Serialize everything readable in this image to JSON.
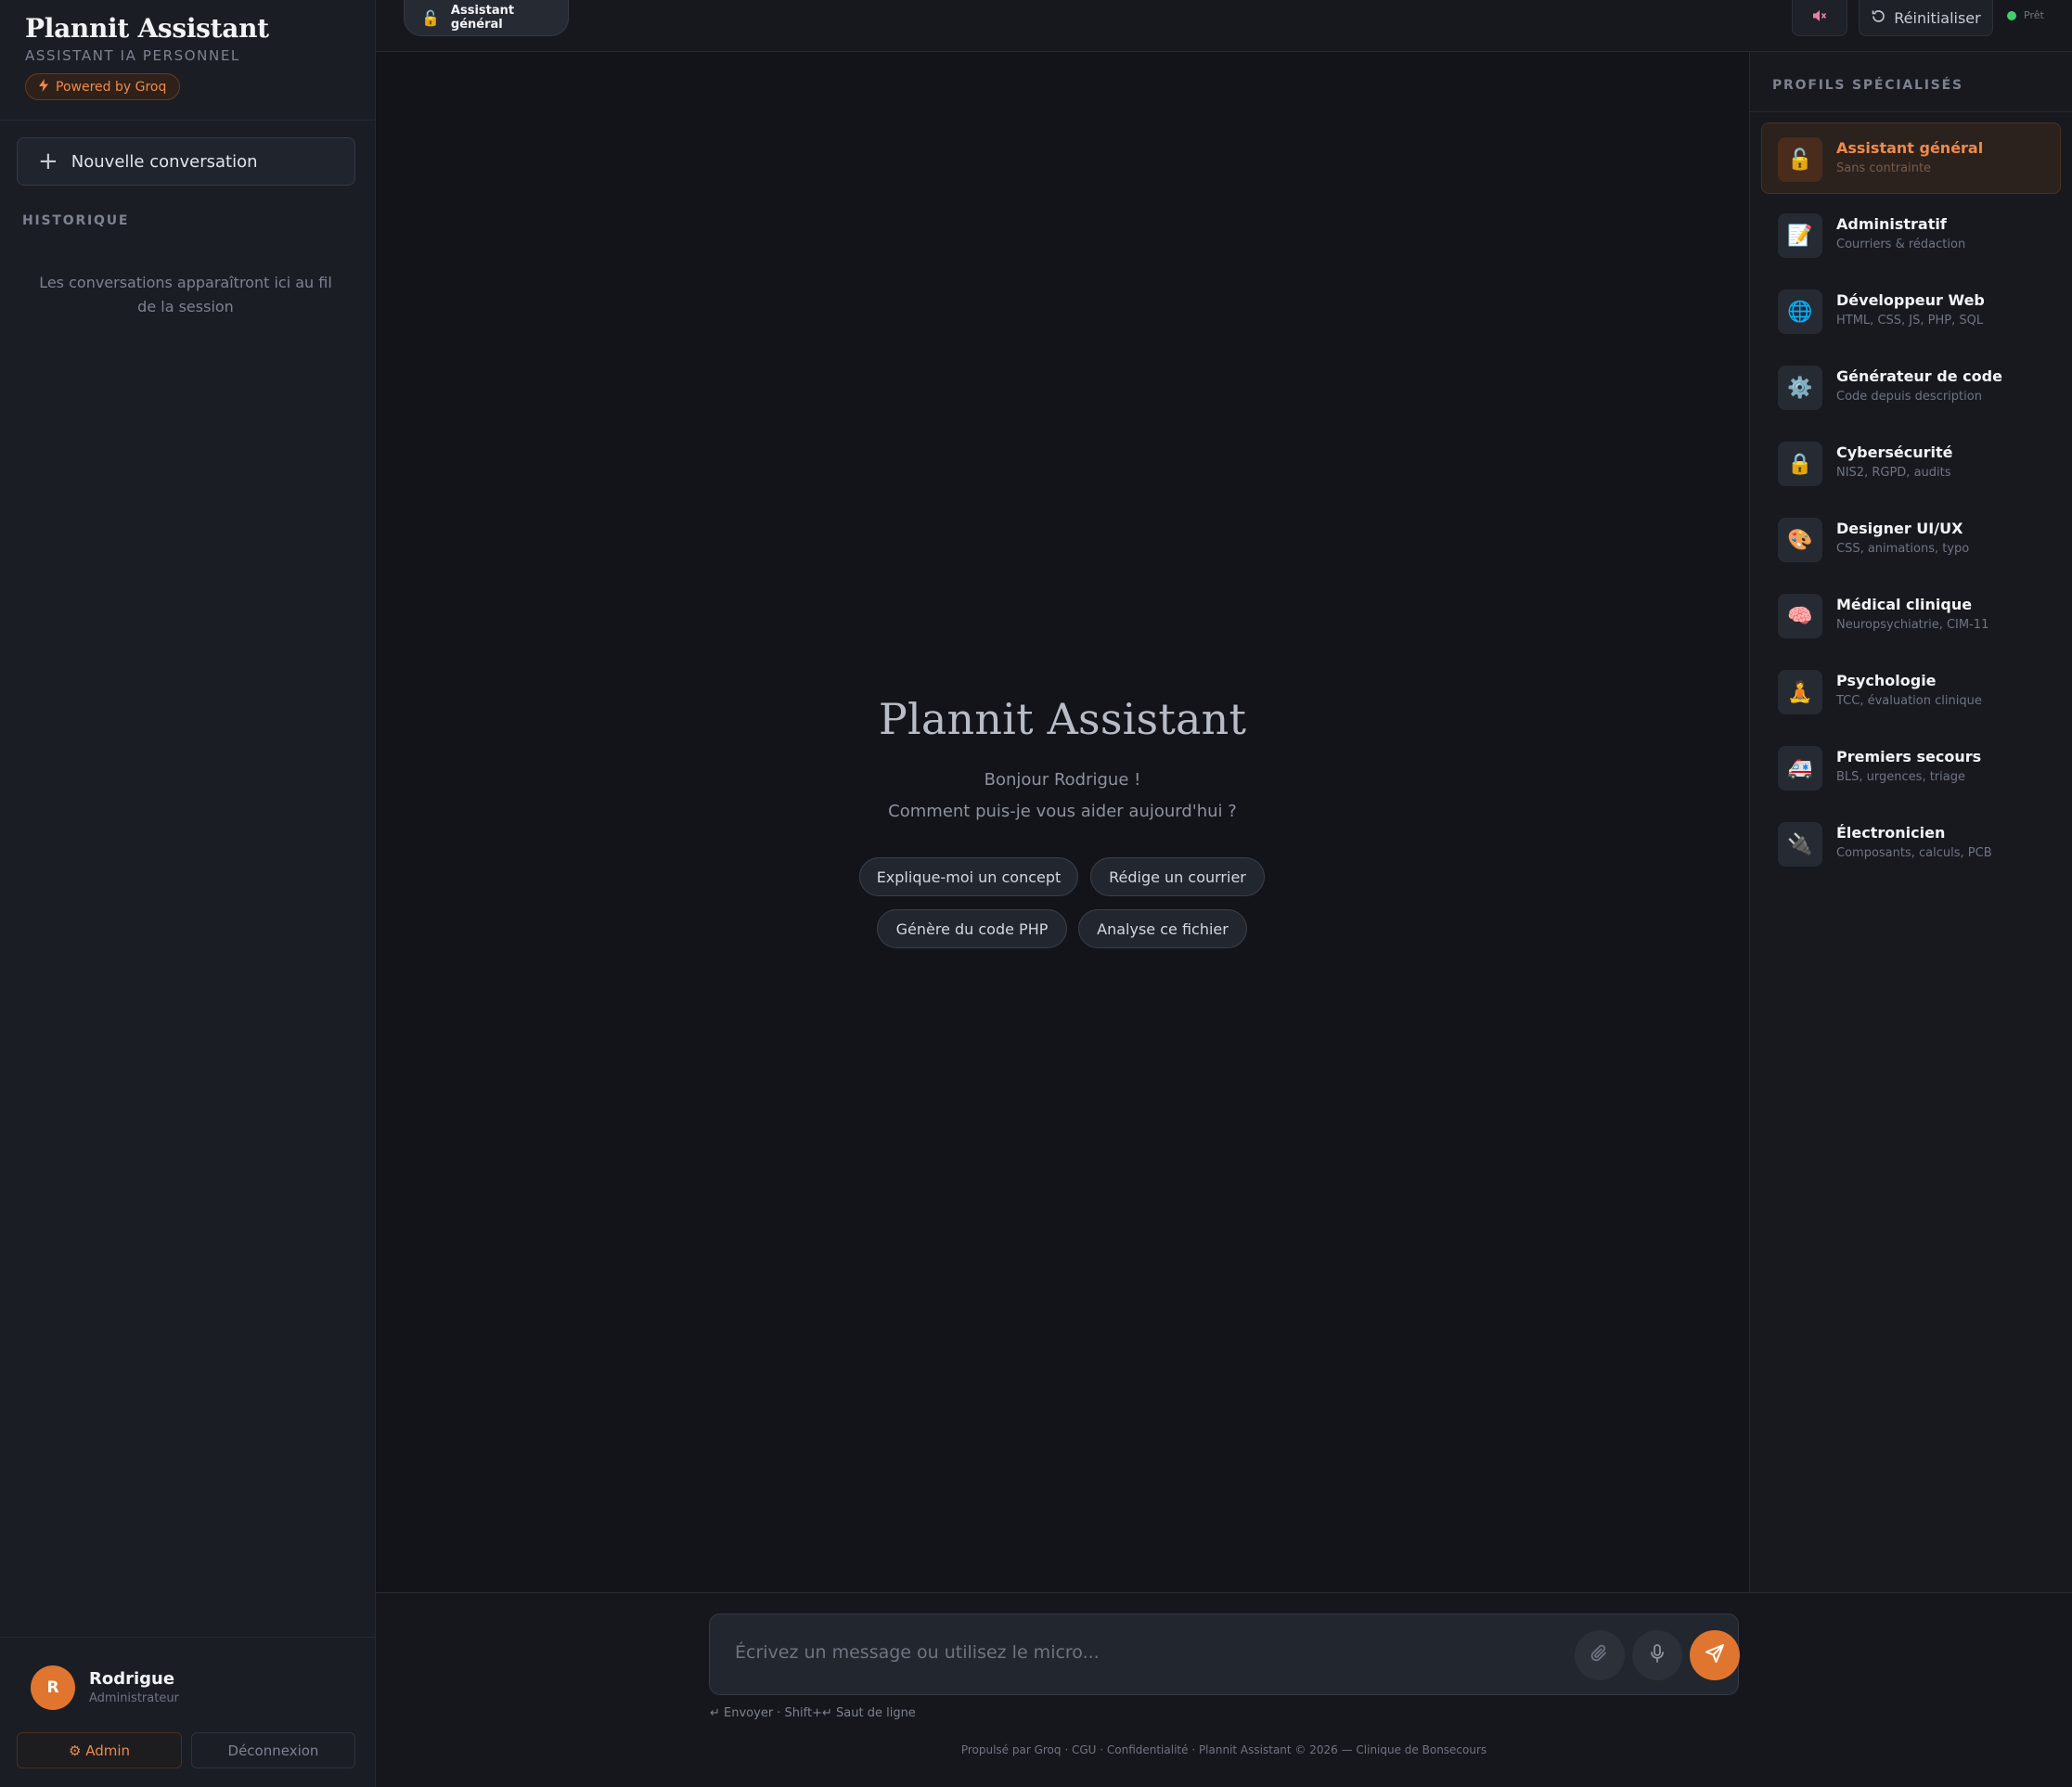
{
  "app": {
    "title": "Plannit Assistant",
    "subtitle": "ASSISTANT IA PERSONNEL",
    "badge": "Powered by Groq"
  },
  "sidebar": {
    "new_conversation": "Nouvelle conversation",
    "history_label": "HISTORIQUE",
    "history_empty": "Les conversations apparaîtront ici au fil de la session",
    "user": {
      "initial": "R",
      "name": "Rodrigue",
      "role": "Administrateur"
    },
    "admin_button": "⚙ Admin",
    "logout_button": "Déconnexion"
  },
  "topbar": {
    "current_profile": "Assistant général",
    "reset_label": "Réinitialiser",
    "status_text": "Prêt"
  },
  "welcome": {
    "title": "Plannit Assistant",
    "greeting": "Bonjour Rodrigue !",
    "question": "Comment puis-je vous aider aujourd'hui ?",
    "suggestions": [
      "Explique-moi un concept",
      "Rédige un courrier",
      "Génère du code PHP",
      "Analyse ce fichier"
    ]
  },
  "profiles_panel": {
    "title": "PROFILS SPÉCIALISÉS",
    "profiles": [
      {
        "name": "Assistant général",
        "desc": "Sans contrainte",
        "icon": "🔓",
        "active": true
      },
      {
        "name": "Administratif",
        "desc": "Courriers & rédaction",
        "icon": "📝"
      },
      {
        "name": "Développeur Web",
        "desc": "HTML, CSS, JS, PHP, SQL",
        "icon": "🌐"
      },
      {
        "name": "Générateur de code",
        "desc": "Code depuis description",
        "icon": "⚙️"
      },
      {
        "name": "Cybersécurité",
        "desc": "NIS2, RGPD, audits",
        "icon": "🔒"
      },
      {
        "name": "Designer UI/UX",
        "desc": "CSS, animations, typo",
        "icon": "🎨"
      },
      {
        "name": "Médical clinique",
        "desc": "Neuropsychiatrie, CIM-11",
        "icon": "🧠"
      },
      {
        "name": "Psychologie",
        "desc": "TCC, évaluation clinique",
        "icon": "🧘"
      },
      {
        "name": "Premiers secours",
        "desc": "BLS, urgences, triage",
        "icon": "🚑"
      },
      {
        "name": "Électronicien",
        "desc": "Composants, calculs, PCB",
        "icon": "🔌"
      }
    ]
  },
  "composer": {
    "placeholder": "Écrivez un message ou utilisez le micro...",
    "hint": "↵ Envoyer · Shift+↵ Saut de ligne",
    "footer": "Propulsé par Groq · CGU · Confidentialité · Plannit Assistant © 2026 — Clinique de Bonsecours"
  },
  "colors": {
    "accent": "#e0752f",
    "background": "#121419",
    "status_ok": "#3ecf6e"
  }
}
